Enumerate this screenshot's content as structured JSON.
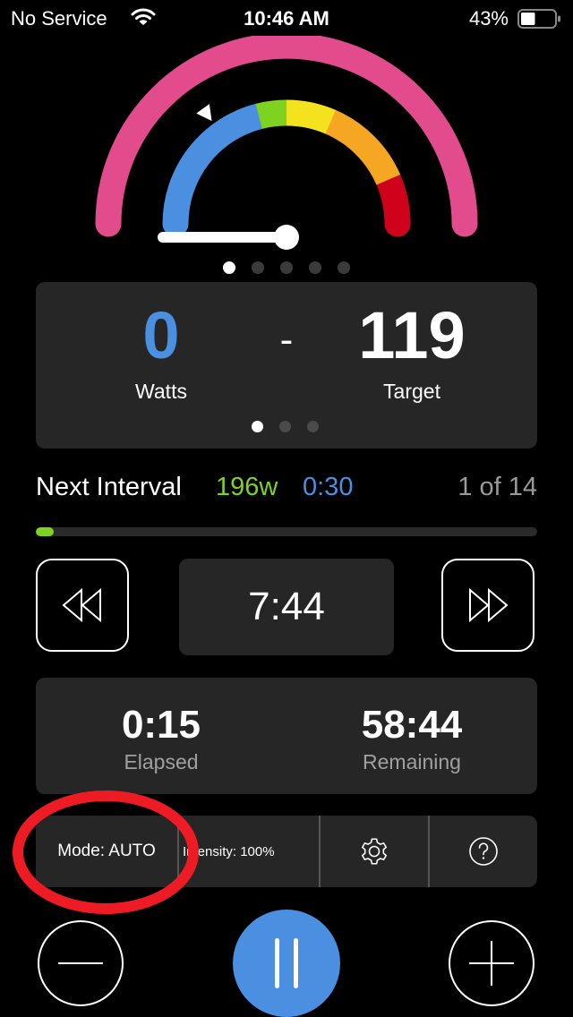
{
  "status_bar": {
    "carrier": "No Service",
    "time": "10:46 AM",
    "battery_percent": "43%",
    "battery_level": 0.43
  },
  "gauge": {
    "outer_color": "#e24c8c",
    "zones": [
      {
        "name": "z1",
        "color": "#4a8fe0"
      },
      {
        "name": "z2",
        "color": "#7ed321"
      },
      {
        "name": "z3",
        "color": "#f5e21f"
      },
      {
        "name": "z4",
        "color": "#f5a623"
      },
      {
        "name": "z5",
        "color": "#d0021b"
      }
    ],
    "zone_fractions": [
      0.42,
      0.08,
      0.13,
      0.24,
      0.13
    ],
    "target_marker_fraction": 0.3,
    "needle_value_fraction": 0.0,
    "page_count": 5,
    "active_page": 0
  },
  "power": {
    "watts_value": "0",
    "watts_label": "Watts",
    "separator": "-",
    "target_value": "119",
    "target_label": "Target",
    "page_count": 3,
    "active_page": 0,
    "watts_color": "#4a8fe0"
  },
  "next_interval": {
    "label": "Next Interval",
    "watts": "196w",
    "duration": "0:30",
    "position": "1 of 14",
    "progress_fraction": 0.035
  },
  "controls": {
    "interval_time": "7:44"
  },
  "times": {
    "elapsed_value": "0:15",
    "elapsed_label": "Elapsed",
    "remaining_value": "58:44",
    "remaining_label": "Remaining"
  },
  "toolbar": {
    "mode_label": "Mode: AUTO",
    "intensity_label": "Intensity: 100%"
  },
  "annotation": {
    "color": "#ed1c24"
  }
}
